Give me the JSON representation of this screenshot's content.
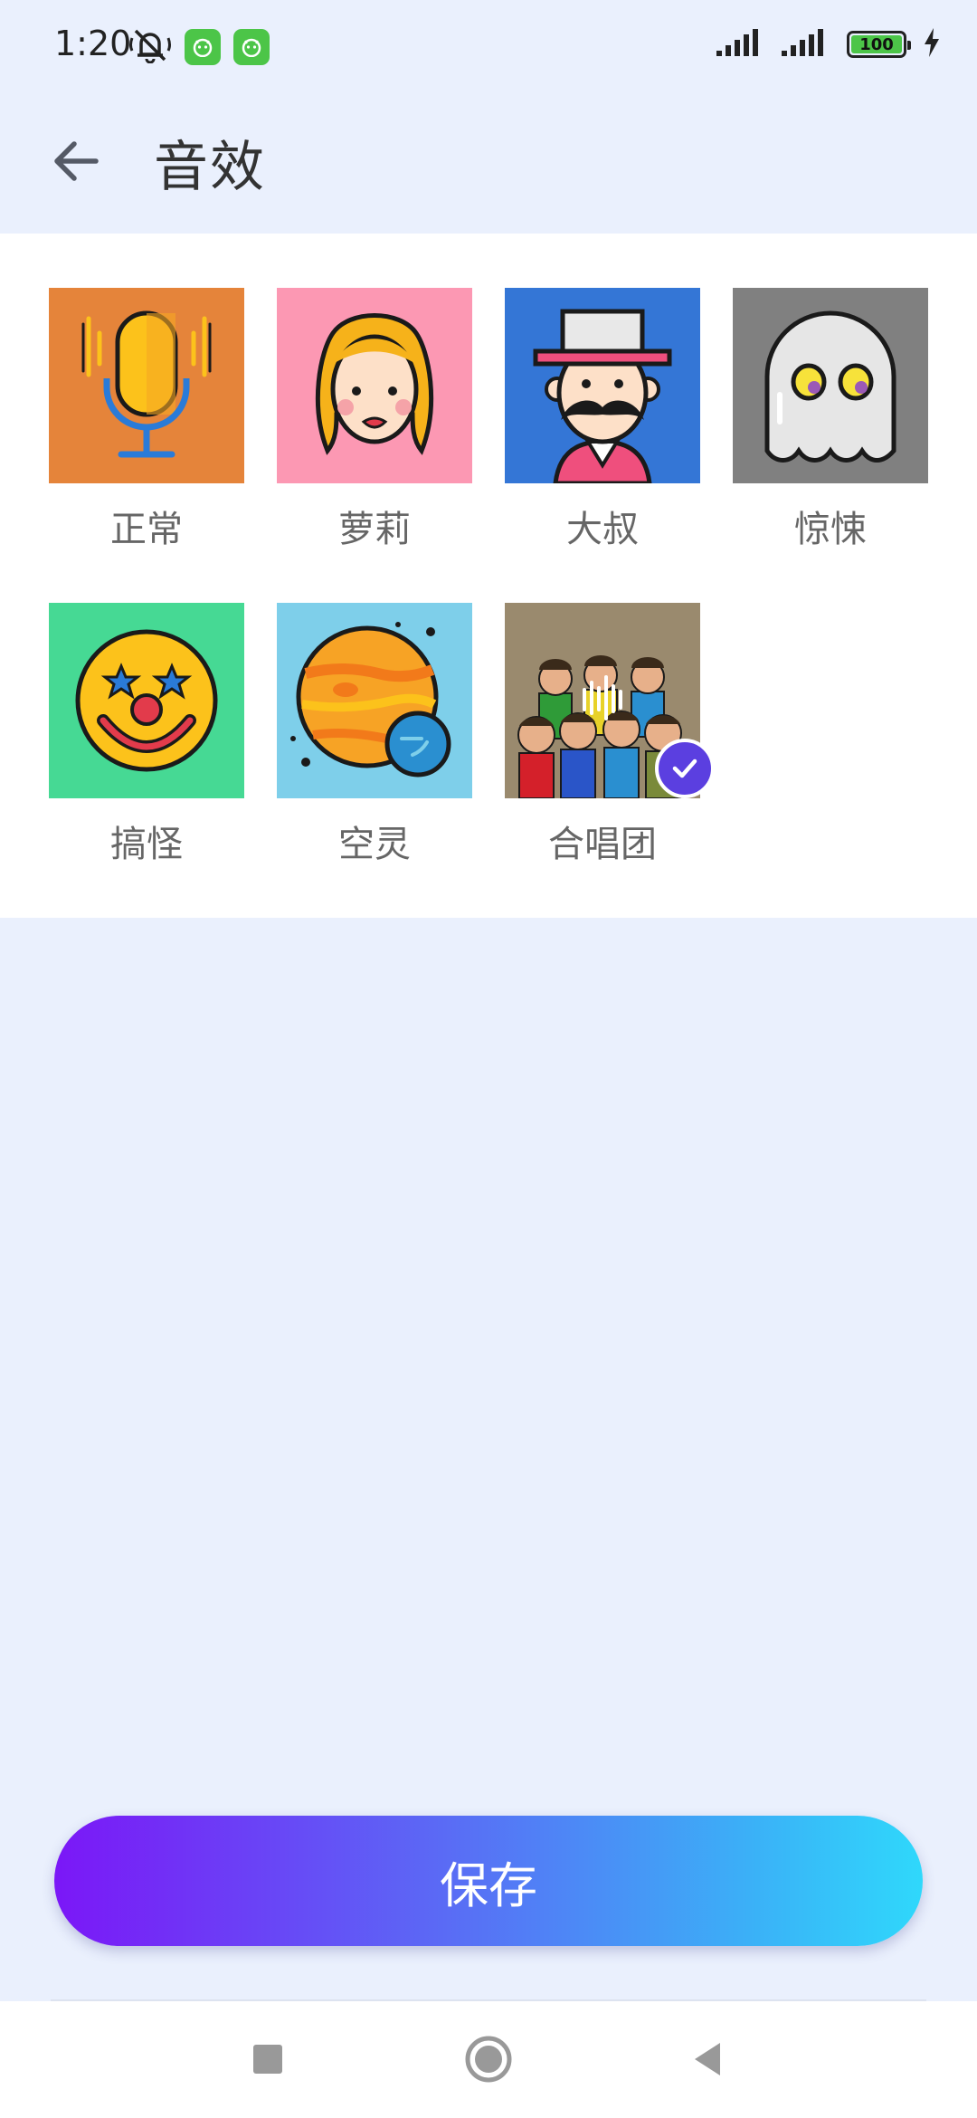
{
  "status": {
    "time": "1:20",
    "battery": "100"
  },
  "header": {
    "title": "音效"
  },
  "effects": [
    {
      "label": "正常",
      "color": "#e5843a",
      "icon": "microphone-icon",
      "selected": false
    },
    {
      "label": "萝莉",
      "color": "#fc98b3",
      "icon": "girl-face-icon",
      "selected": false
    },
    {
      "label": "大叔",
      "color": "#3476d6",
      "icon": "mustache-man-icon",
      "selected": false
    },
    {
      "label": "惊悚",
      "color": "#808080",
      "icon": "ghost-icon",
      "selected": false
    },
    {
      "label": "搞怪",
      "color": "#46d994",
      "icon": "clown-face-icon",
      "selected": false
    },
    {
      "label": "空灵",
      "color": "#7ecfea",
      "icon": "planet-icon",
      "selected": false
    },
    {
      "label": "合唱团",
      "color": "#9a8a6e",
      "icon": "choir-photo-icon",
      "selected": true
    }
  ],
  "save_label": "保存",
  "nav": [
    "recent-apps",
    "home",
    "back"
  ]
}
